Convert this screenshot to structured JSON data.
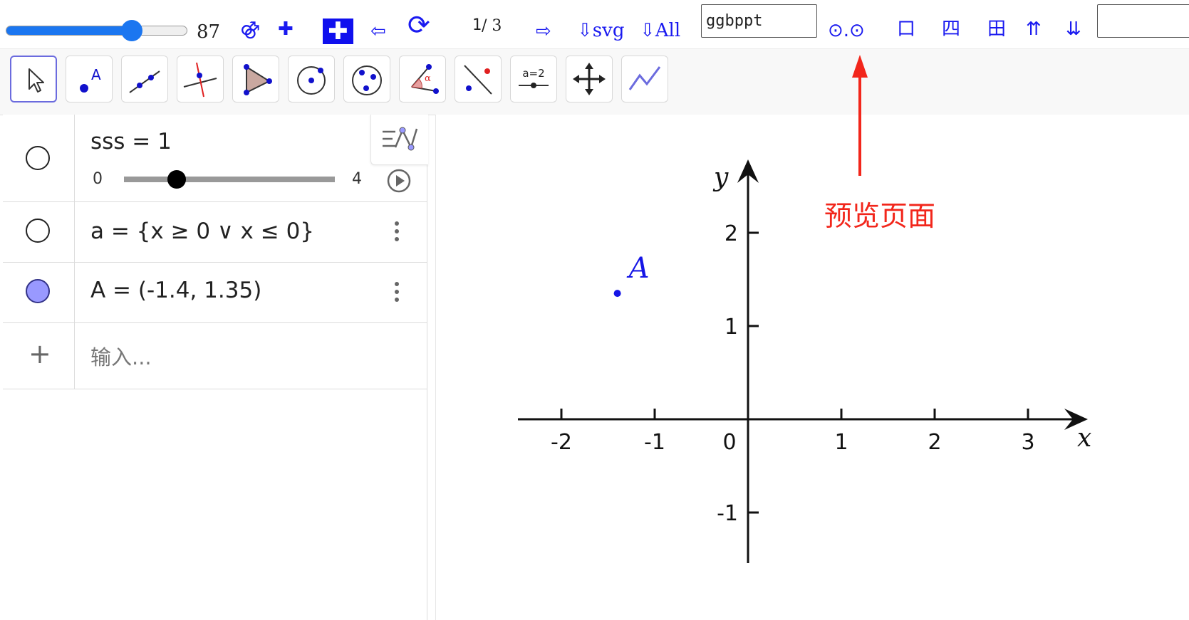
{
  "toolbar": {
    "slider_value": 0.7,
    "slider_label": "87",
    "gender_glyph": "⚣",
    "plus_label": "✚",
    "plus_box_label": "✚",
    "prev_arrow": "⇦",
    "refresh_icon": "⟳",
    "page_current": "1",
    "page_total": "/ 3",
    "next_arrow": "⇨",
    "download_svg": "⇩svg",
    "download_all": "⇩All",
    "filename_value": "ggbppt",
    "preview_label": "⊙.⊙",
    "layout_single": "口",
    "layout_four": "四",
    "layout_grid": "田",
    "move_up": "⇈",
    "move_down": "⇊",
    "right_input_value": ""
  },
  "tools": [
    {
      "name": "move-tool",
      "selected": true
    },
    {
      "name": "point-tool"
    },
    {
      "name": "line-tool"
    },
    {
      "name": "perpendicular-line-tool"
    },
    {
      "name": "polygon-tool"
    },
    {
      "name": "circle-center-point-tool"
    },
    {
      "name": "circle-three-points-tool"
    },
    {
      "name": "angle-tool"
    },
    {
      "name": "reflect-tool"
    },
    {
      "name": "slider-tool",
      "label": "a=2"
    },
    {
      "name": "move-graphics-view-tool"
    },
    {
      "name": "function-tool"
    }
  ],
  "algebra": {
    "rows": [
      {
        "expr": "sss  =  1",
        "slider_min": "0",
        "slider_max": "4",
        "slider_value": 1,
        "visible": false
      },
      {
        "expr": "a  =  {x ≥ 0 ∨ x ≤ 0}",
        "visible": false
      },
      {
        "expr": "A  =  (-1.4, 1.35)",
        "visible": true
      }
    ],
    "input_placeholder": "输入...",
    "add_symbol": "+"
  },
  "graphics": {
    "x_ticks": [
      "-2",
      "-1",
      "0",
      "1",
      "2",
      "3"
    ],
    "y_ticks": [
      "2",
      "1",
      "-1"
    ],
    "x_axis_label": "x",
    "y_axis_label": "y",
    "point": {
      "label": "A",
      "x": -1.4,
      "y": 1.35
    },
    "point_color": "#1515e6",
    "annotation": "预览页面",
    "annotation_color": "#f2261b"
  }
}
